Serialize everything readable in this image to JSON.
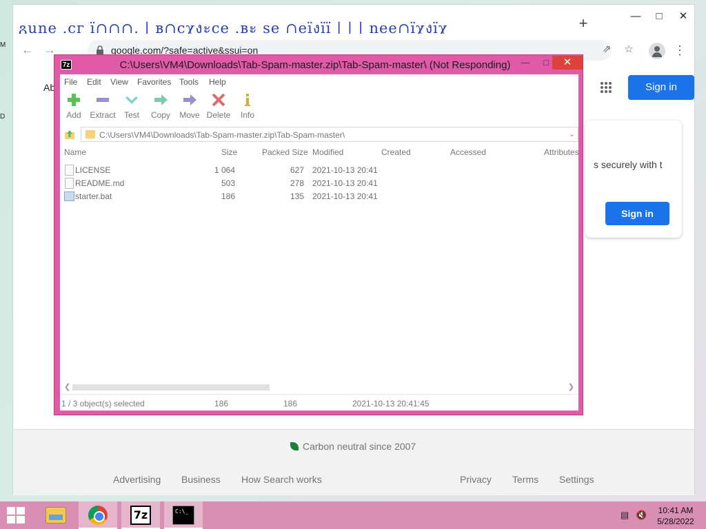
{
  "browser": {
    "tab_strip_text": "გuոе .сг ї∩∩∩. | ʙ∩сχงะсе .ʙะ ѕе ∩еїงїї | | | ոее∩їχงїχ",
    "new_tab_label": "+",
    "url": "google.com/?safe=active&ssui=on",
    "about_label": "About",
    "sign_in_top": "Sign in",
    "card_text": "s securely with t",
    "card_sign_in": "Sign in",
    "carbon_text": "Carbon neutral since 2007",
    "footer_left": [
      "Advertising",
      "Business",
      "How Search works"
    ],
    "footer_right": [
      "Privacy",
      "Terms",
      "Settings"
    ]
  },
  "edge_fragments": [
    "M",
    "D"
  ],
  "sevenzip": {
    "app_icon_text": "7z",
    "title": "C:\\Users\\VM4\\Downloads\\Tab-Spam-master.zip\\Tab-Spam-master\\ (Not Responding)",
    "menu": [
      "File",
      "Edit",
      "View",
      "Favorites",
      "Tools",
      "Help"
    ],
    "toolbar": [
      "Add",
      "Extract",
      "Test",
      "Copy",
      "Move",
      "Delete",
      "Info"
    ],
    "path": "C:\\Users\\VM4\\Downloads\\Tab-Spam-master.zip\\Tab-Spam-master\\",
    "columns": [
      "Name",
      "Size",
      "Packed Size",
      "Modified",
      "Created",
      "Accessed",
      "Attributes"
    ],
    "files": [
      {
        "name": "LICENSE",
        "size": "1 064",
        "packed": "627",
        "modified": "2021-10-13 20:41"
      },
      {
        "name": "README.md",
        "size": "503",
        "packed": "278",
        "modified": "2021-10-13 20:41"
      },
      {
        "name": "starter.bat",
        "size": "186",
        "packed": "135",
        "modified": "2021-10-13 20:41"
      }
    ],
    "status": {
      "selected": "1 / 3 object(s) selected",
      "size": "186",
      "packed": "186",
      "modified": "2021-10-13 20:41:45"
    }
  },
  "taskbar": {
    "cmd_icon_text": "C:\\_",
    "time": "10:41 AM",
    "date": "5/28/2022"
  },
  "colors": {
    "accent_blue": "#1a73e8",
    "zip_frame": "#e05aa8",
    "taskbar": "#d98fb3"
  }
}
